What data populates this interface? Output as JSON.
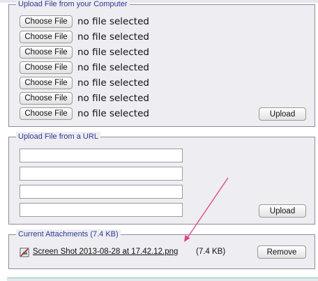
{
  "upload_computer": {
    "legend": "Upload File from your Computer",
    "rows": [
      {
        "button": "Choose File",
        "status": "no file selected"
      },
      {
        "button": "Choose File",
        "status": "no file selected"
      },
      {
        "button": "Choose File",
        "status": "no file selected"
      },
      {
        "button": "Choose File",
        "status": "no file selected"
      },
      {
        "button": "Choose File",
        "status": "no file selected"
      },
      {
        "button": "Choose File",
        "status": "no file selected"
      },
      {
        "button": "Choose File",
        "status": "no file selected"
      }
    ],
    "upload_button": "Upload"
  },
  "upload_url": {
    "legend": "Upload File from a URL",
    "inputs": [
      "",
      "",
      "",
      ""
    ],
    "upload_button": "Upload"
  },
  "attachments": {
    "legend": "Current Attachments (7.4 KB)",
    "items": [
      {
        "name": "Screen Shot 2013-08-28 at 17.42.12.png",
        "size": "(7.4 KB)",
        "remove": "Remove",
        "icon": "image-file-icon"
      }
    ]
  },
  "colors": {
    "legend_text": "#2b3a8f",
    "panel_bg": "#ededf2",
    "arrow": "#e0408a"
  }
}
